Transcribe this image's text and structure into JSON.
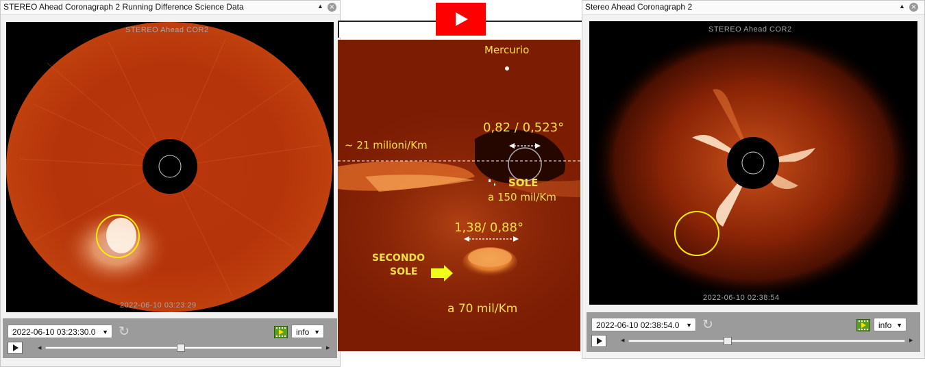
{
  "left_panel": {
    "title": "STEREO Ahead Coronagraph 2 Running Difference Science Data",
    "watermark_top": "STEREO Ahead COR2",
    "watermark_bottom": "2022-06-10 03:23:29",
    "datetime_value": "2022-06-10 03:23:30.0",
    "info_label": "info",
    "slider_position": 0.49
  },
  "right_panel": {
    "title": "Stereo Ahead Coronagraph 2",
    "watermark_top": "STEREO Ahead COR2",
    "watermark_bottom": "2022-06-10 02:38:54",
    "datetime_value": "2022-06-10 02:38:54.0",
    "info_label": "info",
    "slider_position": 0.36
  },
  "center": {
    "mercurio": "Mercurio",
    "ratio_top": "0,82 / 0,523°",
    "distance_line": "~ 21 milioni/Km",
    "sole": "SOLE",
    "sole_distance": "a 150 mil/Km",
    "ratio_bottom": "1,38/ 0,88°",
    "secondo_line1": "SECONDO",
    "secondo_line2": "SOLE",
    "second_distance": "a 70 mil/Km"
  },
  "colors": {
    "annotation_yellow": "#f4e04a",
    "circle_yellow": "#ffee00",
    "youtube_red": "#ff0000"
  },
  "icons": {
    "collapse": "triangle-up-icon",
    "close": "close-icon",
    "refresh": "refresh-icon",
    "film": "film-play-icon",
    "play": "play-icon",
    "youtube": "youtube-play-icon"
  }
}
